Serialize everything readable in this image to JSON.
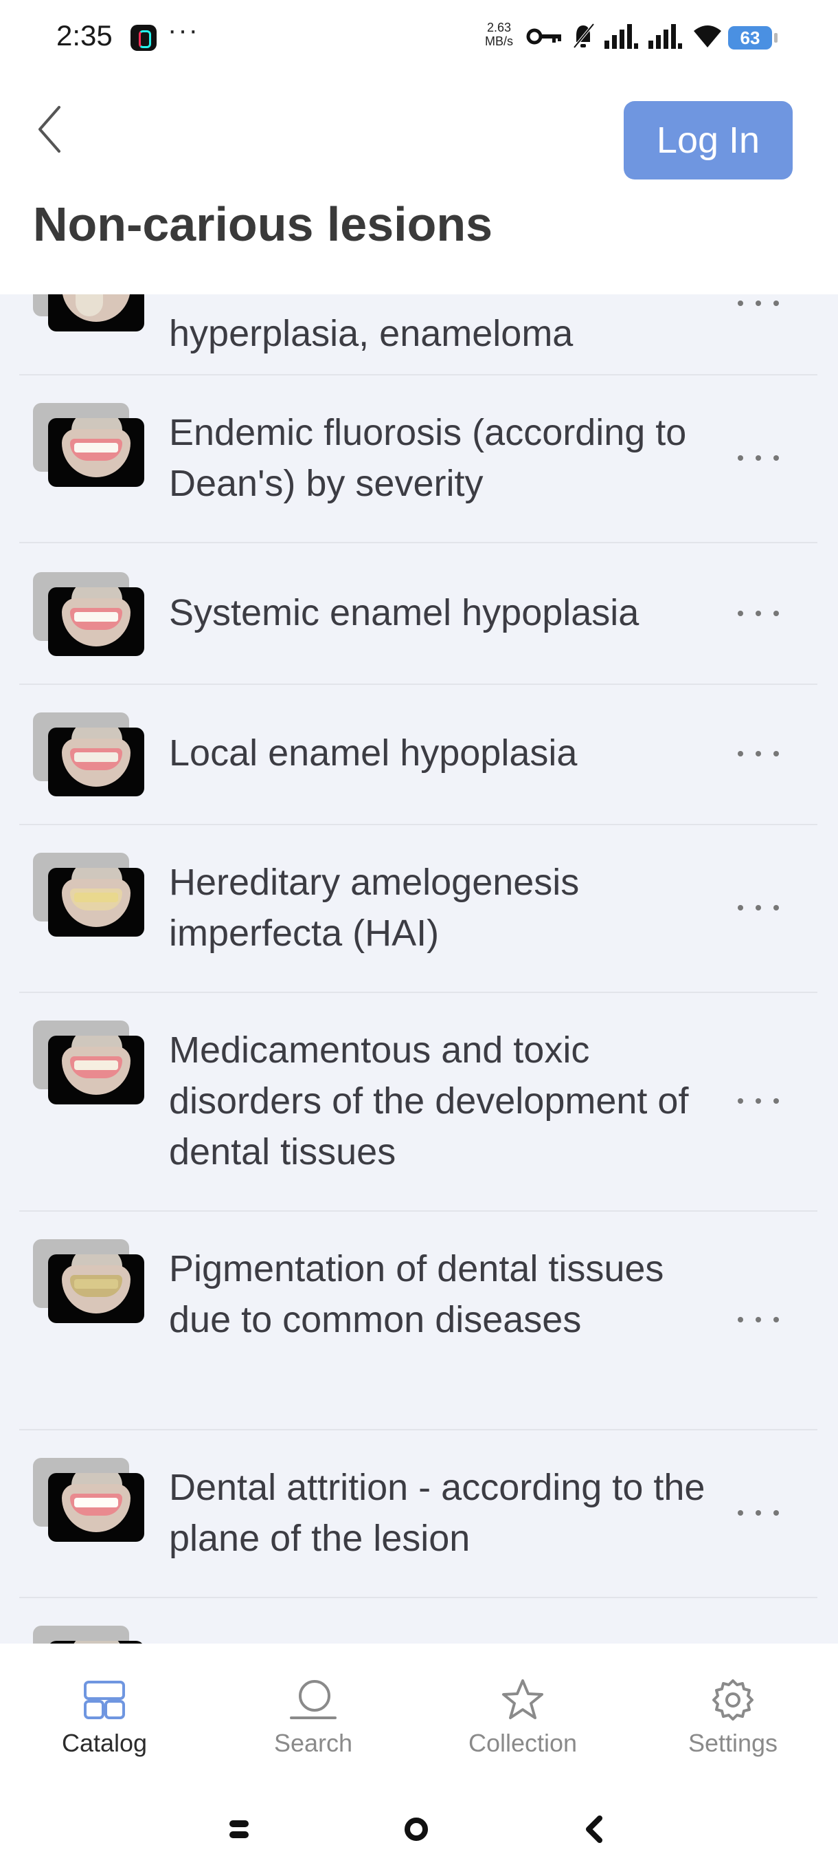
{
  "status_bar": {
    "time": "2:35",
    "more": "···",
    "speed_value": "2.63",
    "speed_unit": "MB/s",
    "battery": "63"
  },
  "header": {
    "title": "Non-carious lesions",
    "login_label": "Log In"
  },
  "list": {
    "items": [
      {
        "label": "hyperplasia, enameloma"
      },
      {
        "label": "Endemic fluorosis (according to Dean's) by severity"
      },
      {
        "label": "Systemic enamel hypoplasia"
      },
      {
        "label": "Local enamel hypoplasia"
      },
      {
        "label": "Hereditary amelogenesis imperfecta (HAI)"
      },
      {
        "label": "Medicamentous and toxic disorders of the development of dental tissues"
      },
      {
        "label": "Pigmentation of dental tissues due to common diseases"
      },
      {
        "label": "Dental attrition - according to the plane of the lesion"
      }
    ]
  },
  "bottom_nav": {
    "tabs": [
      {
        "label": "Catalog",
        "icon": "grid-icon",
        "active": true
      },
      {
        "label": "Search",
        "icon": "search-icon",
        "active": false
      },
      {
        "label": "Collection",
        "icon": "star-icon",
        "active": false
      },
      {
        "label": "Settings",
        "icon": "gear-icon",
        "active": false
      }
    ]
  },
  "colors": {
    "accent": "#6f96e0",
    "list_background": "#f1f3f9",
    "text": "#3c3c43",
    "inactive": "#8a8a8a"
  }
}
